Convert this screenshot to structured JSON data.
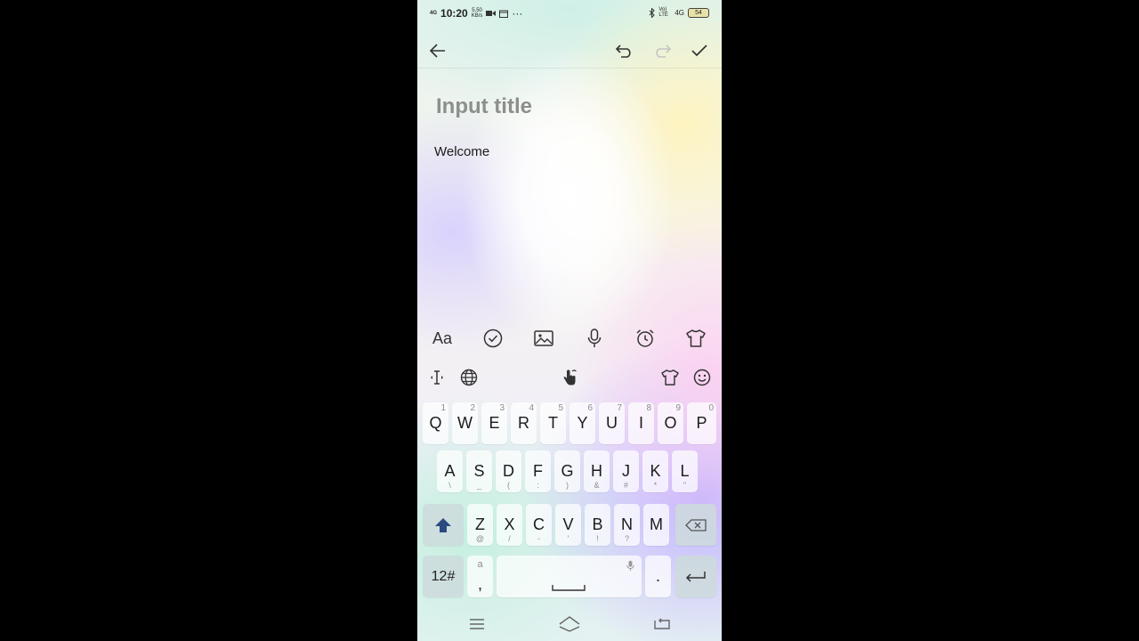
{
  "status_bar": {
    "network_left": "4G",
    "time": "10:20",
    "speed_value": "5.50",
    "speed_unit": "KB/s",
    "more": "···",
    "volte": "Vo) LTE",
    "network_right": "4G",
    "battery": "54"
  },
  "note": {
    "title_placeholder": "Input title",
    "body": "Welcome"
  },
  "format_bar": {
    "font_style_label": "Aa"
  },
  "keyboard": {
    "row1": [
      {
        "k": "Q",
        "h": "1"
      },
      {
        "k": "W",
        "h": "2"
      },
      {
        "k": "E",
        "h": "3"
      },
      {
        "k": "R",
        "h": "4"
      },
      {
        "k": "T",
        "h": "5"
      },
      {
        "k": "Y",
        "h": "6"
      },
      {
        "k": "U",
        "h": "7"
      },
      {
        "k": "I",
        "h": "8"
      },
      {
        "k": "O",
        "h": "9"
      },
      {
        "k": "P",
        "h": "0"
      }
    ],
    "row2": [
      {
        "k": "A",
        "s": "\\"
      },
      {
        "k": "S",
        "s": "_"
      },
      {
        "k": "D",
        "s": "("
      },
      {
        "k": "F",
        "s": ":"
      },
      {
        "k": "G",
        "s": ")"
      },
      {
        "k": "H",
        "s": "&"
      },
      {
        "k": "J",
        "s": "#"
      },
      {
        "k": "K",
        "s": "*"
      },
      {
        "k": "L",
        "s": "\""
      }
    ],
    "row3": [
      {
        "k": "Z",
        "s": "@"
      },
      {
        "k": "X",
        "s": "/"
      },
      {
        "k": "C",
        "s": "-"
      },
      {
        "k": "V",
        "s": "'"
      },
      {
        "k": "B",
        "s": "!"
      },
      {
        "k": "N",
        "s": "?"
      },
      {
        "k": "M",
        "s": ""
      }
    ],
    "numbers_key": "12#",
    "comma_key": ",",
    "comma_hint": "a",
    "period_key": "."
  },
  "colors": {
    "shift_accent": "#2a4a80"
  }
}
